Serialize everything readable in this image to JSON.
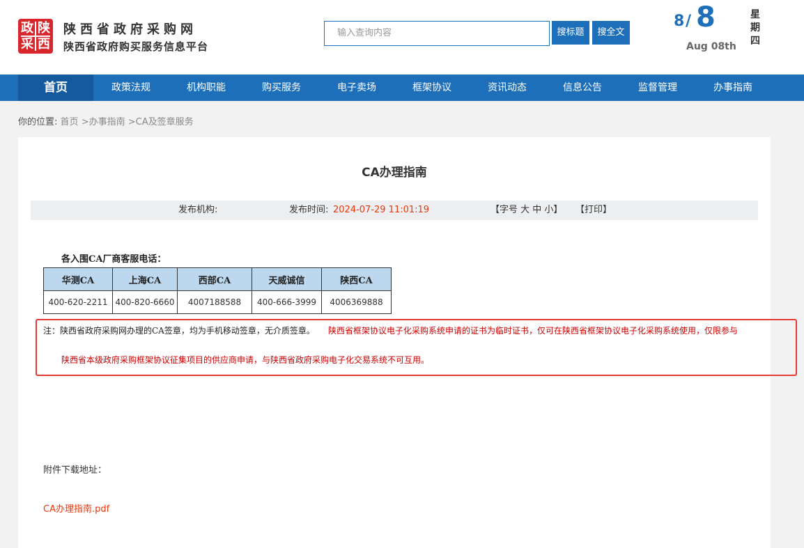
{
  "header": {
    "logo_chars": [
      "政",
      "陕",
      "采",
      "西"
    ],
    "site_title": "陕西省政府采购网",
    "site_subtitle": "陕西省政府购买服务信息平台",
    "search_placeholder": "输入查询内容",
    "search_title_label": "搜标题",
    "search_full_label": "搜全文",
    "date_month": "8",
    "date_slash": "/",
    "date_day": "8",
    "date_en": "Aug 08th",
    "weekday": [
      "星",
      "期",
      "四"
    ]
  },
  "nav": {
    "items": [
      {
        "label": "首页",
        "active": true
      },
      {
        "label": "政策法规"
      },
      {
        "label": "机构职能"
      },
      {
        "label": "购买服务"
      },
      {
        "label": "电子卖场"
      },
      {
        "label": "框架协议"
      },
      {
        "label": "资讯动态"
      },
      {
        "label": "信息公告"
      },
      {
        "label": "监督管理"
      },
      {
        "label": "办事指南"
      }
    ]
  },
  "breadcrumb": {
    "label": "你的位置:",
    "home": "首页",
    "path1": ">办事指南",
    "path2": ">CA及签章服务"
  },
  "article": {
    "title": "CA办理指南",
    "publisher_label": "发布机构:",
    "time_label": "发布时间:",
    "time_value": "2024-07-29 11:01:19",
    "font_size_text": "【字号 大 中 小】",
    "print_text": "【打印】",
    "hotline_title": "各入围CA厂商客服电话：",
    "table_headers": [
      "华测CA",
      "上海CA",
      "西部CA",
      "天威诚信",
      "陕西CA"
    ],
    "table_values": [
      "400-620-2211",
      "400-820-6660",
      "4007188588",
      "400-666-3999",
      "4006369888"
    ],
    "note_prefix": "注：陕西省政府采购网办理的CA签章，均为手机移动签章，无介质签章。",
    "note_red_line1": "陕西省框架协议电子化采购系统申请的证书为临时证书，仅可在陕西省框架协议电子化采购系统使用，仅限参与",
    "note_red_line2": "陕西省本级政府采购框架协议征集项目的供应商申请，与陕西省政府采购电子化交易系统不可互用。",
    "attach_label": "附件下载地址：",
    "attach_link": "CA办理指南.pdf"
  },
  "colors": {
    "brand_blue": "#1d6fba",
    "logo_red": "#d9262c",
    "highlight_red": "#e53935",
    "time_red": "#e8380d"
  }
}
